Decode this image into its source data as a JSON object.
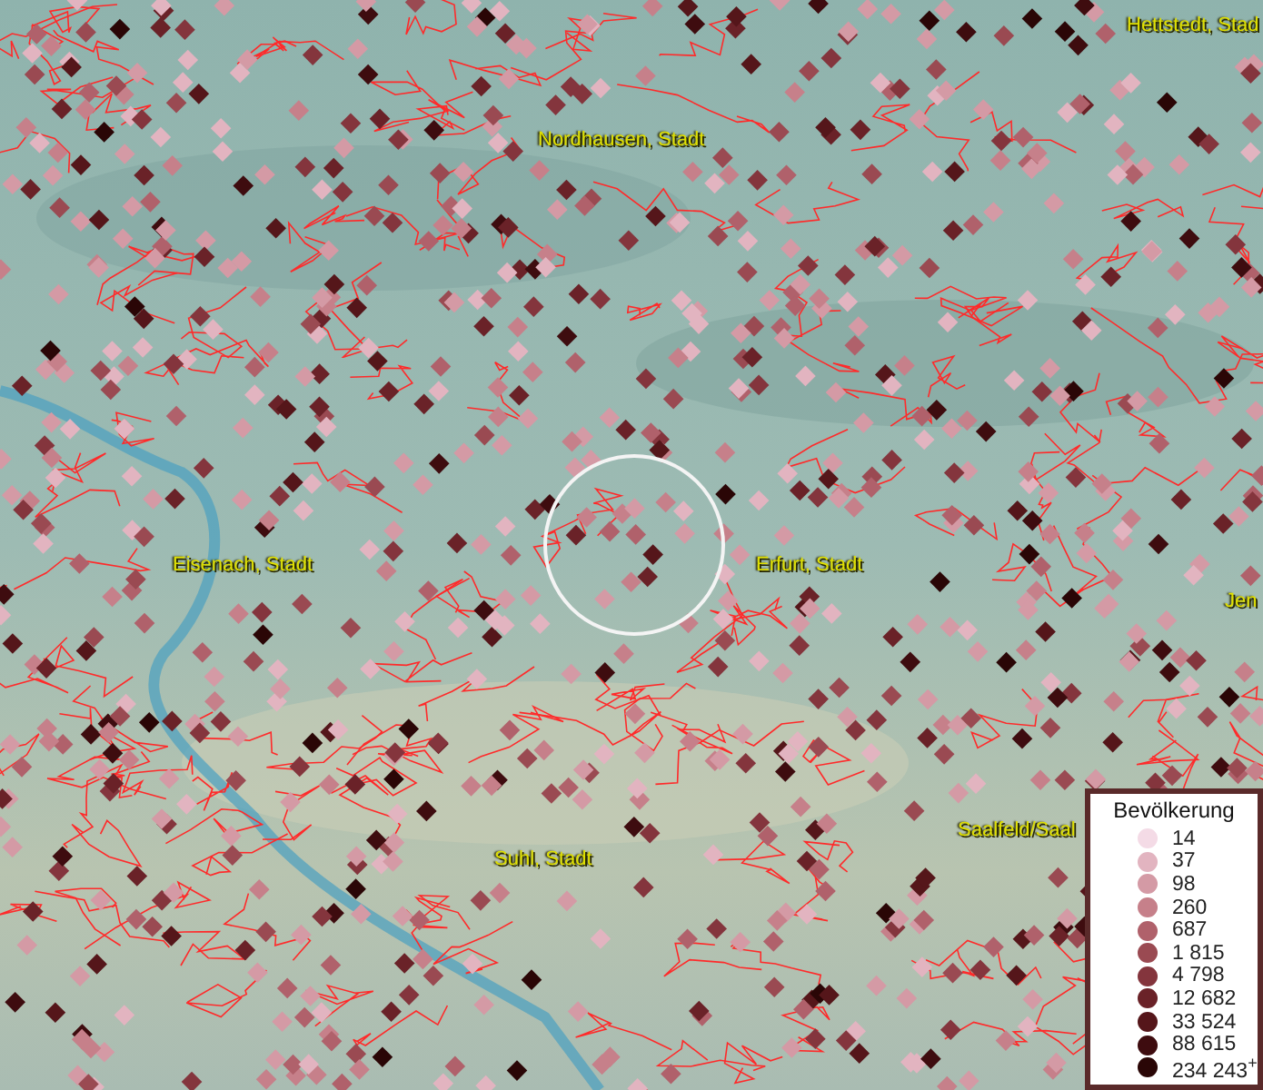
{
  "map": {
    "places": [
      {
        "name": "Hettstedt, Stad"
      },
      {
        "name": "Nordhausen, Stadt"
      },
      {
        "name": "Eisenach, Stadt"
      },
      {
        "name": "Erfurt, Stadt"
      },
      {
        "name": "Jen"
      },
      {
        "name": "Saalfeld/Saal"
      },
      {
        "name": "Suhl, Stadt"
      }
    ]
  },
  "legend": {
    "title": "Bevölkerung",
    "items": [
      {
        "label": "14",
        "color": "#f4dbe6"
      },
      {
        "label": "37",
        "color": "#e2b4c0"
      },
      {
        "label": "98",
        "color": "#d49aa5"
      },
      {
        "label": "260",
        "color": "#c6808a"
      },
      {
        "label": "687",
        "color": "#b0616b"
      },
      {
        "label": "1 815",
        "color": "#9a4a52"
      },
      {
        "label": "4 798",
        "color": "#84353d"
      },
      {
        "label": "12 682",
        "color": "#6a2228"
      },
      {
        "label": "33 524",
        "color": "#55161a"
      },
      {
        "label": "88 615",
        "color": "#3e0c0f"
      },
      {
        "label": "234 243$^{+}$",
        "color": "#2a0606"
      }
    ]
  }
}
